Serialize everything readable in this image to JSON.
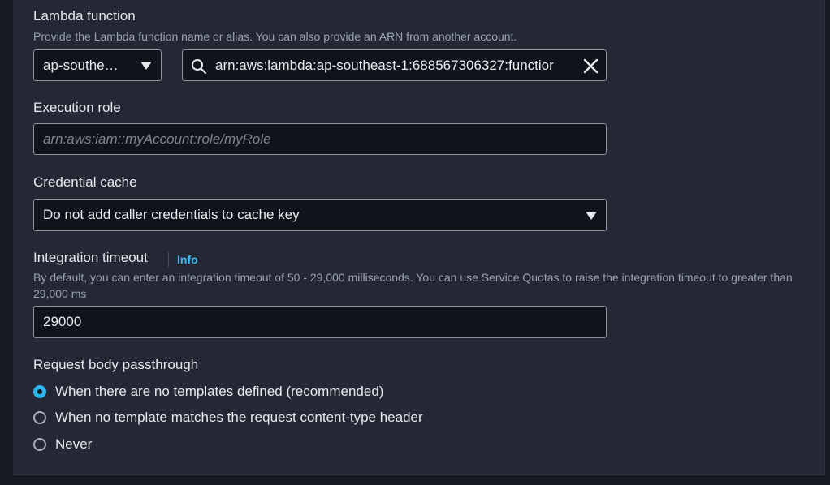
{
  "lambda": {
    "label": "Lambda function",
    "description": "Provide the Lambda function name or alias. You can also provide an ARN from another account.",
    "region_value": "ap-southe…",
    "function_value": "arn:aws:lambda:ap-southeast-1:688567306327:functior"
  },
  "execution_role": {
    "label": "Execution role",
    "placeholder": "arn:aws:iam::myAccount:role/myRole"
  },
  "credential_cache": {
    "label": "Credential cache",
    "value": "Do not add caller credentials to cache key"
  },
  "integration_timeout": {
    "label": "Integration timeout",
    "info": "Info",
    "description": "By default, you can enter an integration timeout of 50 - 29,000 milliseconds. You can use Service Quotas to raise the integration timeout to greater than 29,000 ms",
    "value": "29000"
  },
  "passthrough": {
    "label": "Request body passthrough",
    "options": [
      {
        "label": "When there are no templates defined (recommended)",
        "selected": true
      },
      {
        "label": "When no template matches the request content-type header",
        "selected": false
      },
      {
        "label": "Never",
        "selected": false
      }
    ]
  },
  "icons": {
    "search": "search-icon",
    "clear": "close-icon",
    "dropdown": "caret-down-icon"
  },
  "colors": {
    "background": "#232834",
    "input_bg": "#10131a",
    "link": "#44b9f0",
    "radio_selected": "#2db5f0"
  }
}
